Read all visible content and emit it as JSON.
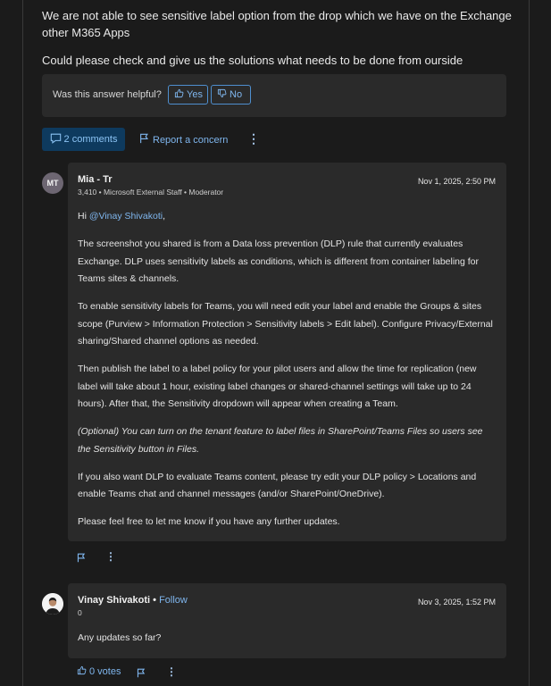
{
  "question": {
    "paragraphs": [
      "We are not able to see sensitive label option from the drop which we have on the Exchange other M365 Apps",
      "Could please check and give us the solutions what needs to be done from ourside"
    ]
  },
  "helpful": {
    "label": "Was this answer helpful?",
    "yes_label": "Yes",
    "no_label": "No"
  },
  "actions": {
    "comments_label": "2 comments",
    "report_label": "Report a concern",
    "more_label": "⋮"
  },
  "comments": [
    {
      "avatar_initials": "MT",
      "author": "Mia - Tr",
      "meta": "3,410 • Microsoft External Staff • Moderator",
      "date": "Nov 1, 2025, 2:50 PM",
      "greeting": "Hi ",
      "mention": "@Vinay Shivakoti",
      "greeting_end": ",",
      "p1": "The screenshot you shared is from a Data loss prevention (DLP) rule that currently evaluates Exchange. DLP uses sensitivity labels as conditions, which is different from container labeling for Teams sites & channels.",
      "p2": "To enable sensitivity labels for Teams, you will need edit your label and enable the Groups & sites scope (Purview > Information Protection > Sensitivity labels > Edit label). Configure Privacy/External sharing/Shared channel options as needed.",
      "p3": "Then publish the label to a label policy for your pilot users and allow the time for replication (new label will take about 1 hour, existing label changes or shared-channel settings will take up to 24 hours). After that, the Sensitivity dropdown will appear when creating a Team.",
      "p4": "(Optional) You can turn on the tenant feature to label files in SharePoint/Teams Files so users see the Sensitivity button in Files.",
      "p5": "If you also want DLP to evaluate Teams content, please try edit your DLP policy > Locations and enable Teams chat and channel messages (and/or SharePoint/OneDrive).",
      "p6": "Please feel free to let me know if you have any further updates."
    },
    {
      "author": "Vinay Shivakoti",
      "separator": " • ",
      "follow_label": "Follow",
      "meta": "0",
      "date": "Nov 3, 2025, 1:52 PM",
      "body": "Any updates so far?",
      "votes_label": "0 votes"
    }
  ],
  "icons": {
    "thumbs_up": "thumbs-up-icon",
    "thumbs_down": "thumbs-down-icon",
    "comment": "comment-icon",
    "flag": "flag-icon",
    "more": "more-vertical-icon"
  },
  "colors": {
    "background": "#1b1b1b",
    "card": "#2a2a2a",
    "link": "#7fb6ee",
    "accent_bg": "#0e3a5e"
  }
}
